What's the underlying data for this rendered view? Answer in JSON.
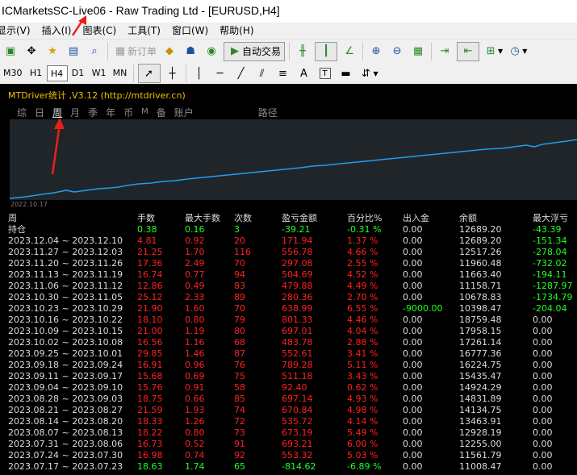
{
  "window": {
    "title": "ICMarketsSC-Live06 - Raw Trading Ltd - [EURUSD,H4]"
  },
  "menu": [
    {
      "label": "显示(V)"
    },
    {
      "label": "插入(I)"
    },
    {
      "label": "图表(C)"
    },
    {
      "label": "工具(T)"
    },
    {
      "label": "窗口(W)"
    },
    {
      "label": "帮助(H)"
    }
  ],
  "toolbar": {
    "new_order": "新订单",
    "auto_trade": "自动交易"
  },
  "timeframes": [
    "M30",
    "H1",
    "H4",
    "D1",
    "W1",
    "MN"
  ],
  "selected_timeframe": "H4",
  "drawtools": {
    "text_a": "A",
    "text_t": "T"
  },
  "indicator": {
    "title": "MTDriver统计 ,V3.12 (http://mtdriver.cn)",
    "tabs": [
      "综",
      "日",
      "周",
      "月",
      "季",
      "年",
      "币",
      "M",
      "备",
      "账户",
      "路径"
    ],
    "active_tab": "周",
    "plot_start_date": "2022.10.17"
  },
  "colors": {
    "profit": "#ff2020",
    "loss": "#20ff20",
    "curve": "#1e9fe8",
    "title": "#f0c000"
  },
  "table": {
    "headers": [
      "周",
      "手数",
      "最大手数",
      "次数",
      "盈亏金额",
      "百分比%",
      "出入金",
      "余额",
      "最大浮亏"
    ],
    "summary": {
      "label": "持仓",
      "lots": "0.38",
      "max_lots": "0.16",
      "count": "3",
      "pnl": "-39.21",
      "pct": "-0.31 %",
      "deposit": "0.00",
      "balance": "12689.20",
      "max_dd": "-43.39"
    },
    "rows": [
      {
        "period": "2023.12.04 ~ 2023.12.10",
        "lots": "4.81",
        "max_lots": "0.92",
        "count": "20",
        "pnl": "171.94",
        "pct": "1.37 %",
        "deposit": "0.00",
        "balance": "12689.20",
        "max_dd": "-151.34",
        "sign": "pos"
      },
      {
        "period": "2023.11.27 ~ 2023.12.03",
        "lots": "21.25",
        "max_lots": "1.70",
        "count": "116",
        "pnl": "556.78",
        "pct": "4.66 %",
        "deposit": "0.00",
        "balance": "12517.26",
        "max_dd": "-278.04",
        "sign": "pos"
      },
      {
        "period": "2023.11.20 ~ 2023.11.26",
        "lots": "17.36",
        "max_lots": "2.49",
        "count": "70",
        "pnl": "297.08",
        "pct": "2.55 %",
        "deposit": "0.00",
        "balance": "11960.48",
        "max_dd": "-732.02",
        "sign": "pos"
      },
      {
        "period": "2023.11.13 ~ 2023.11.19",
        "lots": "16.74",
        "max_lots": "0.77",
        "count": "94",
        "pnl": "504.69",
        "pct": "4.52 %",
        "deposit": "0.00",
        "balance": "11663.40",
        "max_dd": "-194.11",
        "sign": "pos"
      },
      {
        "period": "2023.11.06 ~ 2023.11.12",
        "lots": "12.86",
        "max_lots": "0.49",
        "count": "83",
        "pnl": "479.88",
        "pct": "4.49 %",
        "deposit": "0.00",
        "balance": "11158.71",
        "max_dd": "-1287.97",
        "sign": "pos"
      },
      {
        "period": "2023.10.30 ~ 2023.11.05",
        "lots": "25.12",
        "max_lots": "2.33",
        "count": "89",
        "pnl": "280.36",
        "pct": "2.70 %",
        "deposit": "0.00",
        "balance": "10678.83",
        "max_dd": "-1734.79",
        "sign": "pos"
      },
      {
        "period": "2023.10.23 ~ 2023.10.29",
        "lots": "21.90",
        "max_lots": "1.60",
        "count": "70",
        "pnl": "638.99",
        "pct": "6.55 %",
        "deposit": "-9000.00",
        "balance": "10398.47",
        "max_dd": "-204.04",
        "sign": "pos"
      },
      {
        "period": "2023.10.16 ~ 2023.10.22",
        "lots": "18.10",
        "max_lots": "0.80",
        "count": "79",
        "pnl": "801.33",
        "pct": "4.46 %",
        "deposit": "0.00",
        "balance": "18759.48",
        "max_dd": "0.00",
        "sign": "pos"
      },
      {
        "period": "2023.10.09 ~ 2023.10.15",
        "lots": "21.00",
        "max_lots": "1.19",
        "count": "80",
        "pnl": "697.01",
        "pct": "4.04 %",
        "deposit": "0.00",
        "balance": "17958.15",
        "max_dd": "0.00",
        "sign": "pos"
      },
      {
        "period": "2023.10.02 ~ 2023.10.08",
        "lots": "16.56",
        "max_lots": "1.16",
        "count": "68",
        "pnl": "483.78",
        "pct": "2.88 %",
        "deposit": "0.00",
        "balance": "17261.14",
        "max_dd": "0.00",
        "sign": "pos"
      },
      {
        "period": "2023.09.25 ~ 2023.10.01",
        "lots": "29.85",
        "max_lots": "1.46",
        "count": "87",
        "pnl": "552.61",
        "pct": "3.41 %",
        "deposit": "0.00",
        "balance": "16777.36",
        "max_dd": "0.00",
        "sign": "pos"
      },
      {
        "period": "2023.09.18 ~ 2023.09.24",
        "lots": "16.91",
        "max_lots": "0.96",
        "count": "76",
        "pnl": "789.28",
        "pct": "5.11 %",
        "deposit": "0.00",
        "balance": "16224.75",
        "max_dd": "0.00",
        "sign": "pos"
      },
      {
        "period": "2023.09.11 ~ 2023.09.17",
        "lots": "15.68",
        "max_lots": "0.69",
        "count": "75",
        "pnl": "511.18",
        "pct": "3.43 %",
        "deposit": "0.00",
        "balance": "15435.47",
        "max_dd": "0.00",
        "sign": "pos"
      },
      {
        "period": "2023.09.04 ~ 2023.09.10",
        "lots": "15.76",
        "max_lots": "0.91",
        "count": "58",
        "pnl": "92.40",
        "pct": "0.62 %",
        "deposit": "0.00",
        "balance": "14924.29",
        "max_dd": "0.00",
        "sign": "pos"
      },
      {
        "period": "2023.08.28 ~ 2023.09.03",
        "lots": "18.75",
        "max_lots": "0.66",
        "count": "85",
        "pnl": "697.14",
        "pct": "4.93 %",
        "deposit": "0.00",
        "balance": "14831.89",
        "max_dd": "0.00",
        "sign": "pos"
      },
      {
        "period": "2023.08.21 ~ 2023.08.27",
        "lots": "21.59",
        "max_lots": "1.93",
        "count": "74",
        "pnl": "670.84",
        "pct": "4.98 %",
        "deposit": "0.00",
        "balance": "14134.75",
        "max_dd": "0.00",
        "sign": "pos"
      },
      {
        "period": "2023.08.14 ~ 2023.08.20",
        "lots": "18.33",
        "max_lots": "1.26",
        "count": "72",
        "pnl": "535.72",
        "pct": "4.14 %",
        "deposit": "0.00",
        "balance": "13463.91",
        "max_dd": "0.00",
        "sign": "pos"
      },
      {
        "period": "2023.08.07 ~ 2023.08.13",
        "lots": "18.22",
        "max_lots": "0.80",
        "count": "73",
        "pnl": "673.19",
        "pct": "5.49 %",
        "deposit": "0.00",
        "balance": "12928.19",
        "max_dd": "0.00",
        "sign": "pos"
      },
      {
        "period": "2023.07.31 ~ 2023.08.06",
        "lots": "16.73",
        "max_lots": "0.52",
        "count": "91",
        "pnl": "693.21",
        "pct": "6.00 %",
        "deposit": "0.00",
        "balance": "12255.00",
        "max_dd": "0.00",
        "sign": "pos"
      },
      {
        "period": "2023.07.24 ~ 2023.07.30",
        "lots": "16.98",
        "max_lots": "0.74",
        "count": "92",
        "pnl": "553.32",
        "pct": "5.03 %",
        "deposit": "0.00",
        "balance": "11561.79",
        "max_dd": "0.00",
        "sign": "pos"
      },
      {
        "period": "2023.07.17 ~ 2023.07.23",
        "lots": "18.63",
        "max_lots": "1.74",
        "count": "65",
        "pnl": "-814.62",
        "pct": "-6.89 %",
        "deposit": "0.00",
        "balance": "11008.47",
        "max_dd": "0.00",
        "sign": "neg"
      }
    ]
  }
}
